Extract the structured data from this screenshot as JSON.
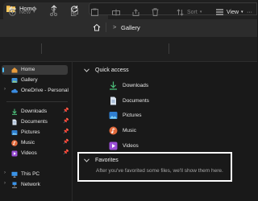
{
  "window": {
    "tab_title": "Home",
    "close_glyph": "✕",
    "new_tab_glyph": "+"
  },
  "address": {
    "path_separator": ">",
    "current": "Gallery"
  },
  "toolbar": {
    "new_label": "New",
    "sort_label": "Sort",
    "view_label": "View"
  },
  "sidebar": {
    "top_items": [
      {
        "label": "Home",
        "icon": "home-icon",
        "selected": true
      },
      {
        "label": "Gallery",
        "icon": "gallery-icon"
      },
      {
        "label": "OneDrive - Personal",
        "icon": "cloud-icon"
      }
    ],
    "pinned_items": [
      {
        "label": "Downloads",
        "icon": "download-icon"
      },
      {
        "label": "Documents",
        "icon": "documents-icon"
      },
      {
        "label": "Pictures",
        "icon": "pictures-icon"
      },
      {
        "label": "Music",
        "icon": "music-icon"
      },
      {
        "label": "Videos",
        "icon": "videos-icon"
      }
    ],
    "bottom_items": [
      {
        "label": "This PC",
        "icon": "pc-icon"
      },
      {
        "label": "Network",
        "icon": "network-icon"
      }
    ]
  },
  "main": {
    "quick_access_header": "Quick access",
    "quick_access_items": [
      {
        "label": "Downloads",
        "icon": "download-icon"
      },
      {
        "label": "Documents",
        "icon": "documents-icon"
      },
      {
        "label": "Pictures",
        "icon": "pictures-icon"
      },
      {
        "label": "Music",
        "icon": "music-icon"
      },
      {
        "label": "Videos",
        "icon": "videos-icon"
      }
    ],
    "favorites_header": "Favorites",
    "favorites_empty_message": "After you've favorited some files, we'll show them here."
  },
  "colors": {
    "background": "#191919",
    "accent": "#4cc2ff",
    "highlight_border": "#ffffff"
  }
}
